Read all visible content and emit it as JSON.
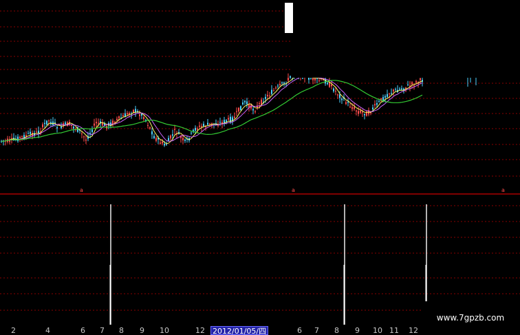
{
  "chart_data": {
    "type": "candlestick",
    "x_axis_labels": [
      "2",
      "4",
      "6",
      "7",
      "8",
      "9",
      "10",
      "12",
      "2012/01/05/四",
      "6",
      "7",
      "8",
      "9",
      "10",
      "11",
      "12"
    ],
    "cursor_date": "2012/01/05/四",
    "signal_markers": [
      "a",
      "a",
      "a"
    ]
  },
  "watermark": "www.7gpzb.com",
  "colors": {
    "background": "#000000",
    "up_candle": "#ff4d4d",
    "down_candle": "#4dd2ff",
    "ma_short": "#ffff66",
    "ma_mid": "#cc66ff",
    "ma_long": "#33cc33",
    "grid": "#8b0000",
    "divider": "#cc0000",
    "signal": "#ffffff"
  }
}
